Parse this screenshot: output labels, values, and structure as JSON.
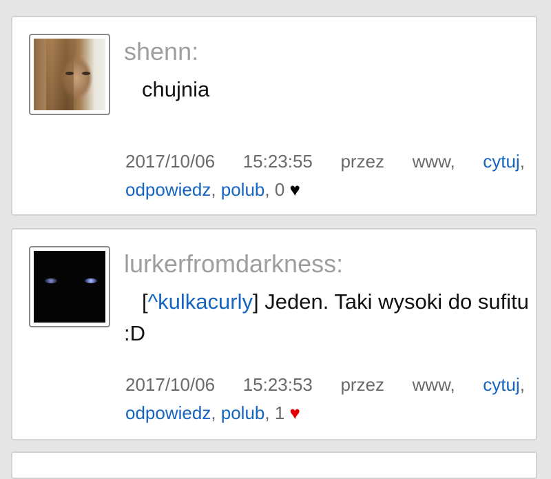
{
  "posts": [
    {
      "username": "shenn:",
      "text": "chujnia",
      "date": "2017/10/06",
      "time": "15:23:55",
      "via_label": "przez",
      "via": "www,",
      "quote_label": "cytuj",
      "reply_label": "odpowiedz",
      "like_label": "polub",
      "like_count": "0",
      "heart": "♥",
      "heart_color": "#000000"
    },
    {
      "username": "lurkerfromdarkness:",
      "mention_open": "[",
      "mention": "^kulkacurly",
      "mention_close": "]",
      "text": " Jeden. Taki wysoki do sufitu :D",
      "date": "2017/10/06",
      "time": "15:23:53",
      "via_label": "przez",
      "via": "www,",
      "quote_label": "cytuj",
      "reply_label": "odpowiedz",
      "like_label": "polub",
      "like_count": "1",
      "heart": "♥",
      "heart_color": "#e00000"
    }
  ],
  "colors": {
    "link": "#1565c0",
    "username": "#9e9e9e",
    "background": "#e6e6e6"
  }
}
